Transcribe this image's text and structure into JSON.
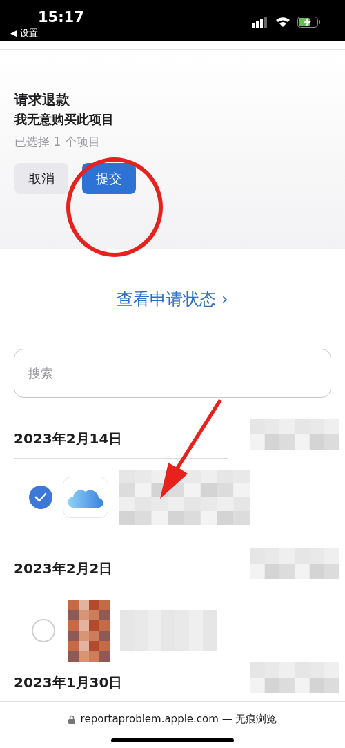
{
  "status_bar": {
    "time": "15:17",
    "back_label": "◀ 设置"
  },
  "refund_panel": {
    "title": "请求退款",
    "reason": "我无意购买此项目",
    "selection_count": "已选择 1 个项目",
    "buttons": [
      {
        "label": "取消",
        "kind": "secondary"
      },
      {
        "label": "提交",
        "kind": "primary"
      }
    ]
  },
  "status_link": "查看申请状态 ›",
  "search": {
    "placeholder": "搜索"
  },
  "purchase_groups": [
    {
      "date": "2023年2月14日",
      "items": [
        {
          "selected": true,
          "kind": "cloud"
        }
      ]
    },
    {
      "date": "2023年2月2日"
    },
    {
      "date": "2023年1月30日"
    }
  ],
  "address_bar": {
    "url": "reportaproblem.apple.com — 无痕浏览"
  }
}
